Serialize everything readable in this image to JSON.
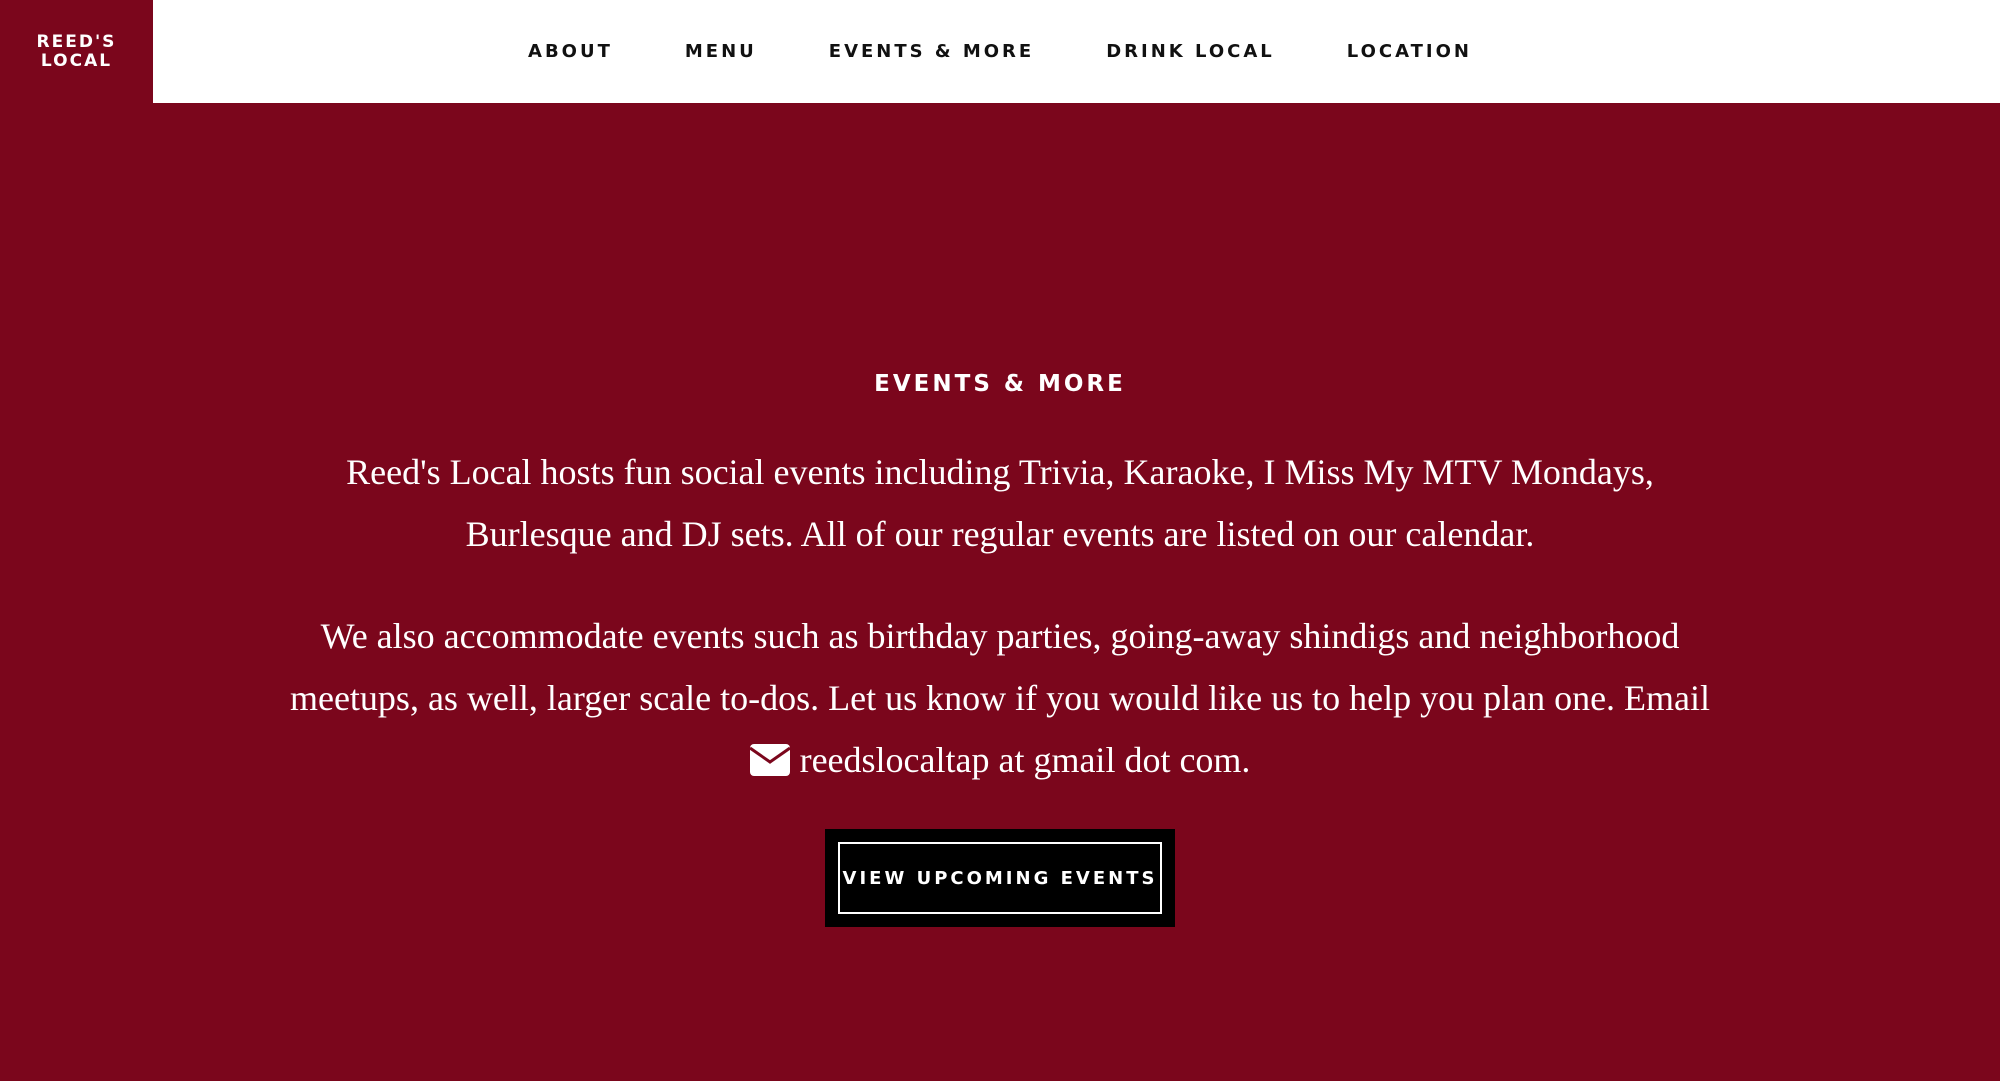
{
  "brand": {
    "line1": "REED'S",
    "line2": "LOCAL",
    "color": "#7b061c"
  },
  "nav": {
    "items": [
      {
        "label": "ABOUT"
      },
      {
        "label": "MENU"
      },
      {
        "label": "EVENTS & MORE"
      },
      {
        "label": "DRINK LOCAL"
      },
      {
        "label": "LOCATION"
      }
    ]
  },
  "section": {
    "title": "EVENTS & MORE",
    "para1_line1": "Reed's Local hosts fun social events including Trivia, Karaoke, I Miss My MTV Mondays,",
    "para1_line2": "Burlesque and DJ sets. All of our regular events are listed on our calendar.",
    "para2_line1": "We also accommodate events such as birthday parties, going-away shindigs and neighborhood",
    "para2_line2": "meetups, as well, larger scale to-dos. Let us know if you would like us to help you plan one. Email",
    "para2_line3": "reedslocaltap at gmail dot com.",
    "email_icon": "envelope-icon",
    "button_label": "VIEW UPCOMING EVENTS"
  },
  "colors": {
    "background": "#7b061c",
    "header": "#ffffff",
    "button": "#000000",
    "text": "#ffffff"
  }
}
